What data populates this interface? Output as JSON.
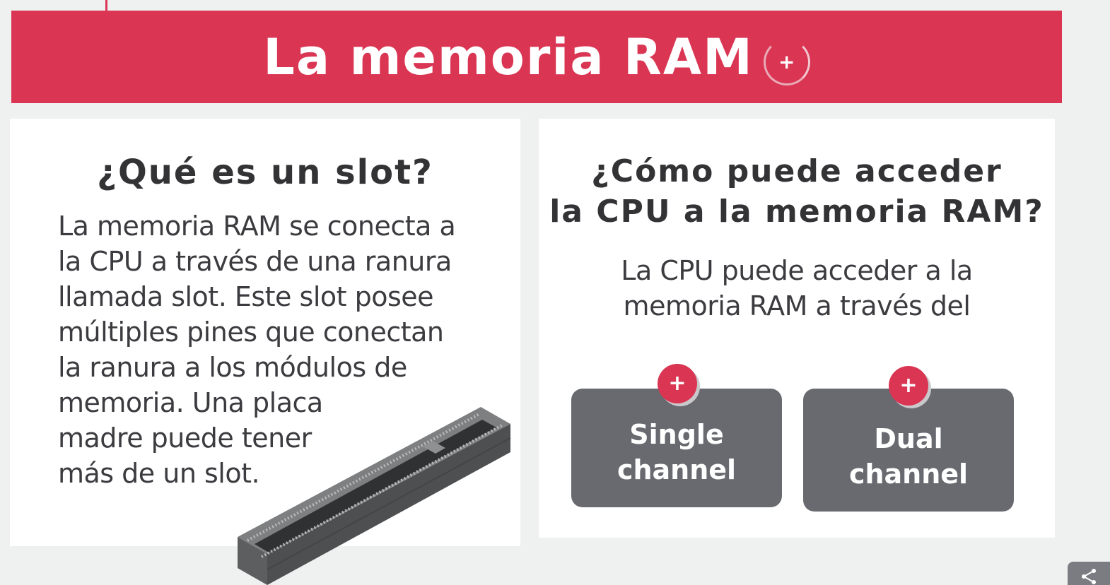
{
  "header": {
    "title": "La memoria RAM",
    "plus_label": "+"
  },
  "slot_card": {
    "title": "¿Qué es un slot?",
    "lines": [
      "La memoria RAM se conecta a",
      "la CPU a través de una ranura",
      "llamada slot. Este slot posee",
      "múltiples pines que conectan",
      "la ranura a los módulos de",
      "memoria. Una placa",
      "madre puede tener",
      "más de un slot."
    ]
  },
  "access_card": {
    "title_line1": "¿Cómo puede acceder",
    "title_line2": "la CPU a la memoria RAM?",
    "text_line1": "La CPU puede acceder a la",
    "text_line2": "memoria RAM a través del",
    "buttons": [
      {
        "line1": "Single",
        "line2": "channel",
        "plus": "+"
      },
      {
        "line1": "Dual",
        "line2": "channel",
        "plus": "+"
      }
    ]
  },
  "icons": {
    "header_plus": "plus-icon",
    "slot_image": "ram-slot-illustration",
    "share": "share-icon"
  },
  "colors": {
    "accent": "#da3552",
    "button_gray": "#686a70",
    "background": "#eff1f0",
    "text": "#333336"
  }
}
